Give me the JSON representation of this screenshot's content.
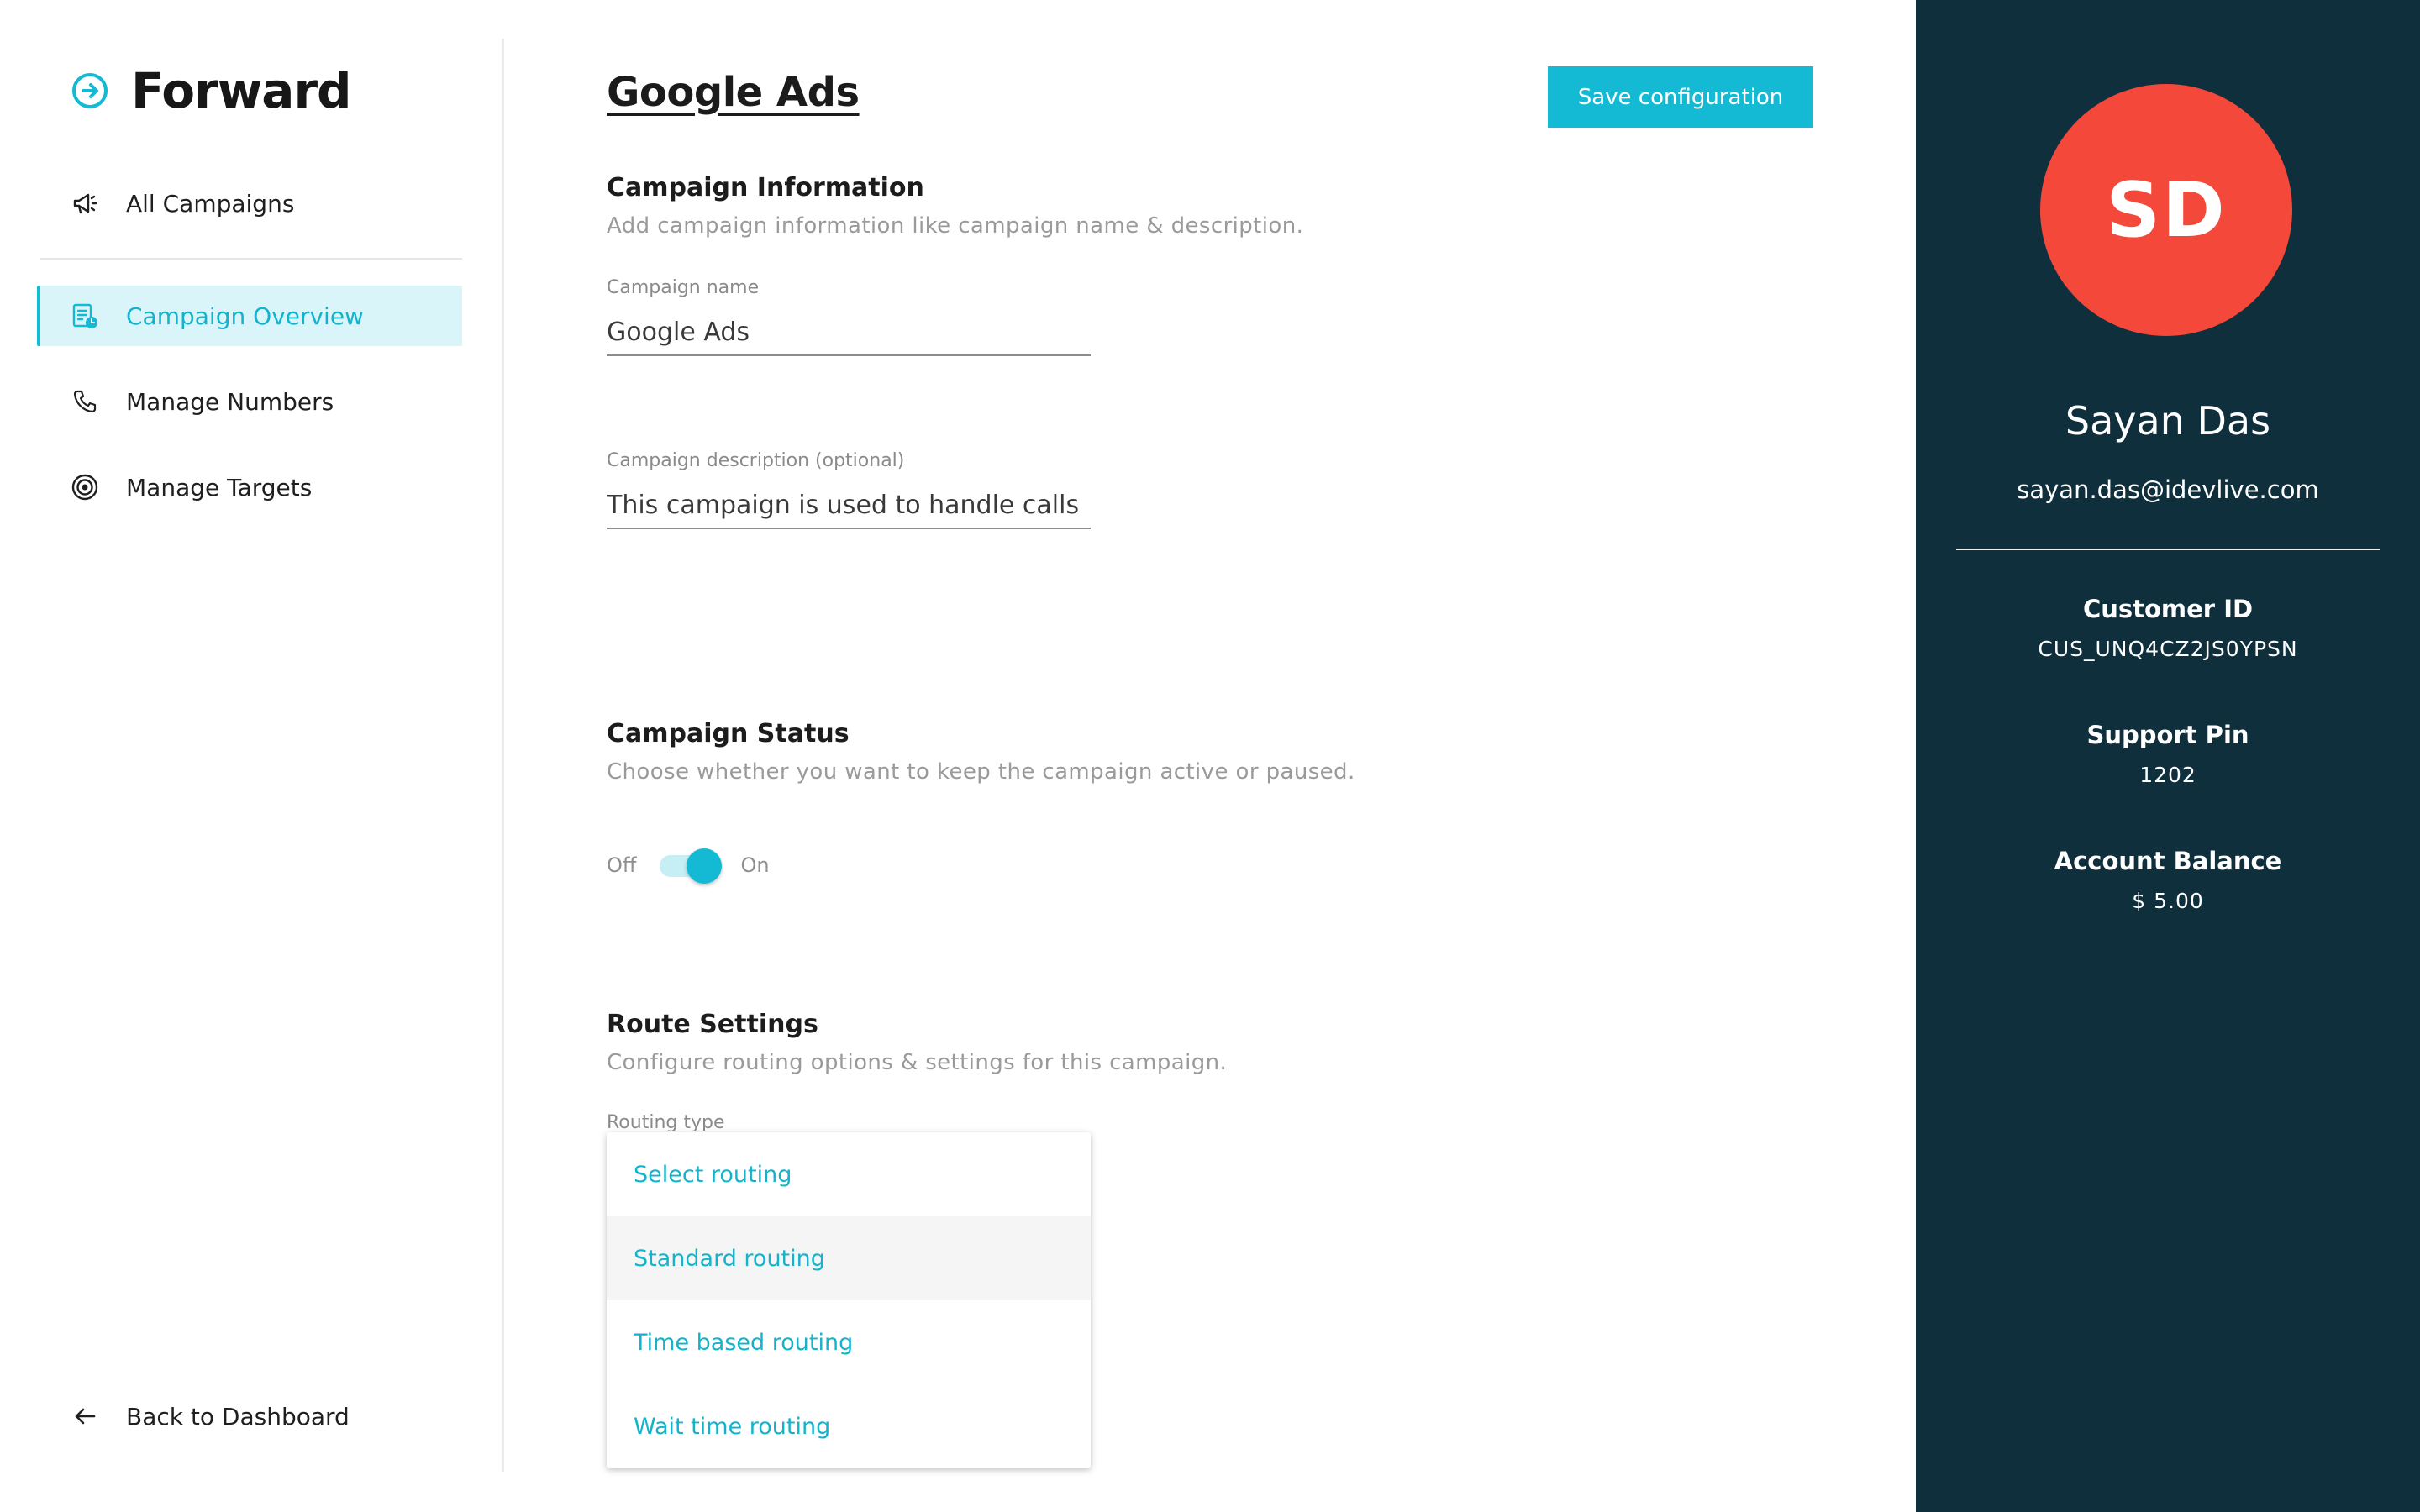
{
  "app": {
    "name": "Forward"
  },
  "sidebar": {
    "items": [
      {
        "label": "All Campaigns",
        "icon": "megaphone-icon"
      },
      {
        "label": "Campaign Overview",
        "icon": "campaign-overview-icon",
        "active": true
      },
      {
        "label": "Manage Numbers",
        "icon": "phone-icon"
      },
      {
        "label": "Manage Targets",
        "icon": "target-icon"
      }
    ],
    "back_label": "Back to Dashboard"
  },
  "main": {
    "title": "Google Ads",
    "save_label": "Save configuration",
    "campaign_info": {
      "title": "Campaign Information",
      "subtitle": "Add campaign information like campaign name & description.",
      "name_label": "Campaign name",
      "name_value": "Google Ads",
      "description_label": "Campaign description (optional)",
      "description_value": "This campaign is used to handle calls"
    },
    "campaign_status": {
      "title": "Campaign Status",
      "subtitle": "Choose whether you want to keep the campaign active or paused.",
      "off_label": "Off",
      "on_label": "On",
      "active": true
    },
    "route_settings": {
      "title": "Route Settings",
      "subtitle": "Configure routing options & settings for this campaign.",
      "routing_label": "Routing type",
      "options": [
        "Select routing",
        "Standard routing",
        "Time based routing",
        "Wait time routing"
      ],
      "hovered_option": "Standard routing"
    }
  },
  "profile": {
    "initials": "SD",
    "name": "Sayan Das",
    "email": "sayan.das@idevlive.com",
    "customer_id_label": "Customer ID",
    "customer_id": "CUS_UNQ4CZ2JS0YPSN",
    "support_pin_label": "Support Pin",
    "support_pin": "1202",
    "balance_label": "Account Balance",
    "balance": "$ 5.00"
  },
  "colors": {
    "accent": "#14bad3",
    "panel_bg": "#0f2f3d",
    "avatar_bg": "#f3483a",
    "active_nav_bg": "#daf5fa"
  }
}
